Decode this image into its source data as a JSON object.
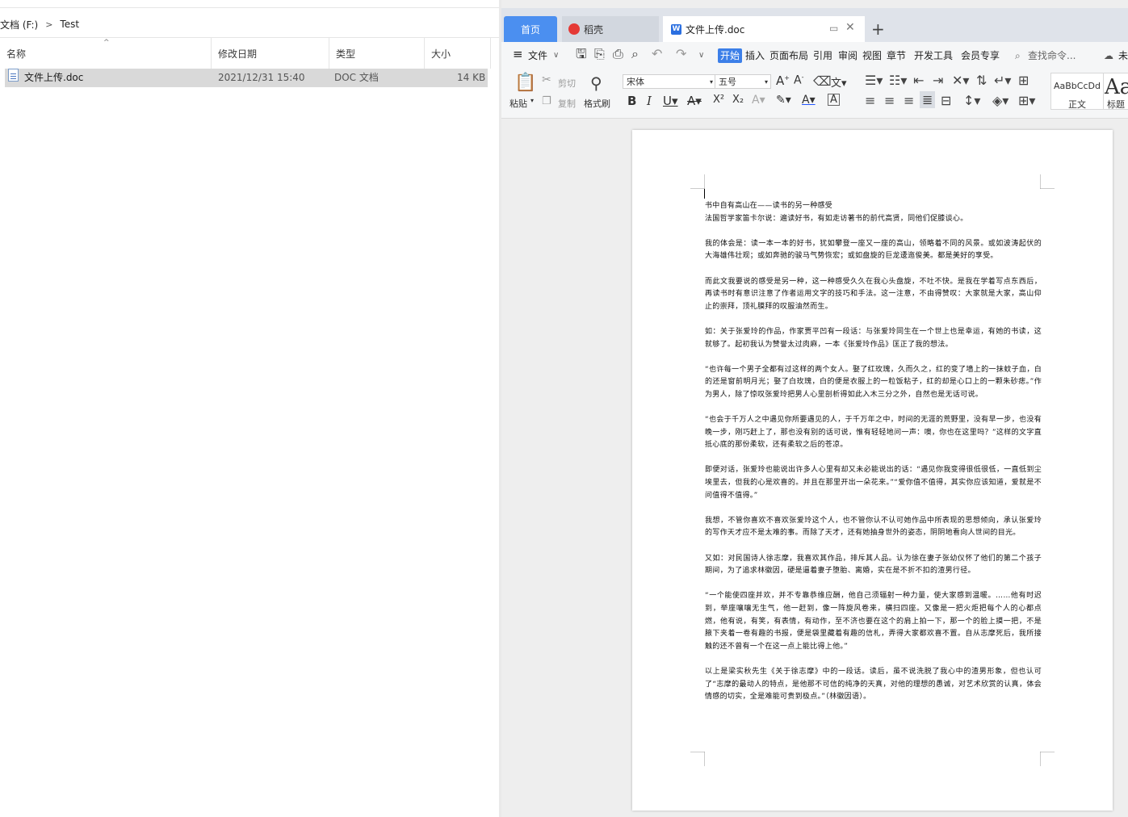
{
  "explorer": {
    "breadcrumb": [
      "文档 (F:)",
      "Test"
    ],
    "columns": [
      "名称",
      "修改日期",
      "类型",
      "大小"
    ],
    "files": [
      {
        "name": "文件上传.doc",
        "modified": "2021/12/31 15:40",
        "type": "DOC 文档",
        "size": "14 KB"
      }
    ]
  },
  "wps": {
    "tabs": {
      "home": "首页",
      "daoke": "稻壳",
      "doc": "文件上传.doc",
      "add": "+"
    },
    "menu": {
      "file": "文件",
      "items": [
        "开始",
        "插入",
        "页面布局",
        "引用",
        "审阅",
        "视图",
        "章节",
        "开发工具",
        "会员专享"
      ],
      "search": "查找命令...",
      "cloud": "未"
    },
    "toolbar": {
      "paste": "粘贴",
      "cut": "剪切",
      "copy": "复制",
      "format_painter": "格式刷",
      "font": "宋体",
      "size": "五号",
      "style_sample": "AaBbCcDd",
      "style_name": "正文",
      "style_sample2": "Aa",
      "style_name2": "标题"
    },
    "document": {
      "paragraphs": [
        "书中自有高山在——读书的另一种感受",
        "法国哲学家笛卡尔说：遍读好书，有如走访著书的前代高贤，同他们促膝谈心。",
        "我的体会是：读一本一本的好书，犹如攀登一座又一座的高山，领略着不同的风景。或如波涛起伏的大海雄伟壮观；或如奔驰的骏马气势恢宏；或如盘旋的巨龙逶迤俊美。都是美好的享受。",
        "而此文我要说的感受是另一种，这一种感受久久在我心头盘旋，不吐不快。是我在学着写点东西后，再读书时有意识注意了作者运用文字的技巧和手法。这一注意，不由得赞叹：大家就是大家，高山仰止的崇拜，顶礼膜拜的叹服油然而生。",
        "如：关于张爱玲的作品，作家贾平凹有一段话：与张爱玲同生在一个世上也是幸运，有她的书读，这就够了。起初我认为赞誉太过肉麻，一本《张爱玲作品》匡正了我的想法。",
        "“也许每一个男子全都有过这样的两个女人。娶了红玫瑰，久而久之，红的变了墙上的一抹蚊子血，白的还是窗前明月光；娶了白玫瑰，白的便是衣服上的一粒饭粘子，红的却是心口上的一颗朱砂痣。”作为男人，除了惊叹张爱玲把男人心里剖析得如此入木三分之外，自然也是无话可说。",
        "“也会于千万人之中遇见你所要遇见的人，于千万年之中，时间的无涯的荒野里，没有早一步，也没有晚一步，刚巧赶上了，那也没有别的话可说，惟有轻轻地问一声：噢，你也在这里吗？”这样的文字直抵心底的那份柔软，还有柔软之后的苍凉。",
        "即便对话，张爱玲也能说出许多人心里有却又未必能说出的话：“遇见你我变得很低很低，一直低到尘埃里去，但我的心是欢喜的。并且在那里开出一朵花来。”“爱你值不值得，其实你应该知道，爱就是不问值得不值得。”",
        "我想，不管你喜欢不喜欢张爱玲这个人，也不管你认不认可她作品中所表现的思想倾向，承认张爱玲的写作天才应不是太难的事。而除了天才，还有她抽身世外的姿态，阴阴地看向人世间的目光。",
        "又如：对民国诗人徐志摩，我喜欢其作品，排斥其人品。认为徐在妻子张幼仪怀了他们的第二个孩子期间，为了追求林徽因，硬是逼着妻子堕胎、离婚，实在是不折不扣的渣男行径。",
        "“一个能使四座并欢，并不专靠恭维应酬，他自己须辐射一种力量，使大家感到温暖。……他有时迟到，举座嚷嚷无生气，他一赶到，像一阵旋风卷来，横扫四座。又像是一把火炬把每个人的心都点燃，他有说，有笑，有表情，有动作，至不济也要在这个的肩上拍一下，那一个的脸上摸一把，不是腋下夹着一卷有趣的书报，便是袋里藏着有趣的信札，弄得大家都欢喜不置。自从志摩死后，我所接触的还不曾有一个在这一点上能比得上他。”",
        "以上是梁实秋先生《关于徐志摩》中的一段话。读后，虽不说洗脱了我心中的渣男形象，但也认可了“志摩的最动人的特点，是他那不可信的纯净的天真，对他的理想的愚诚，对艺术欣赏的认真，体会情感的切实，全是难能可贵到极点。”（林徽因语）。"
      ]
    }
  }
}
